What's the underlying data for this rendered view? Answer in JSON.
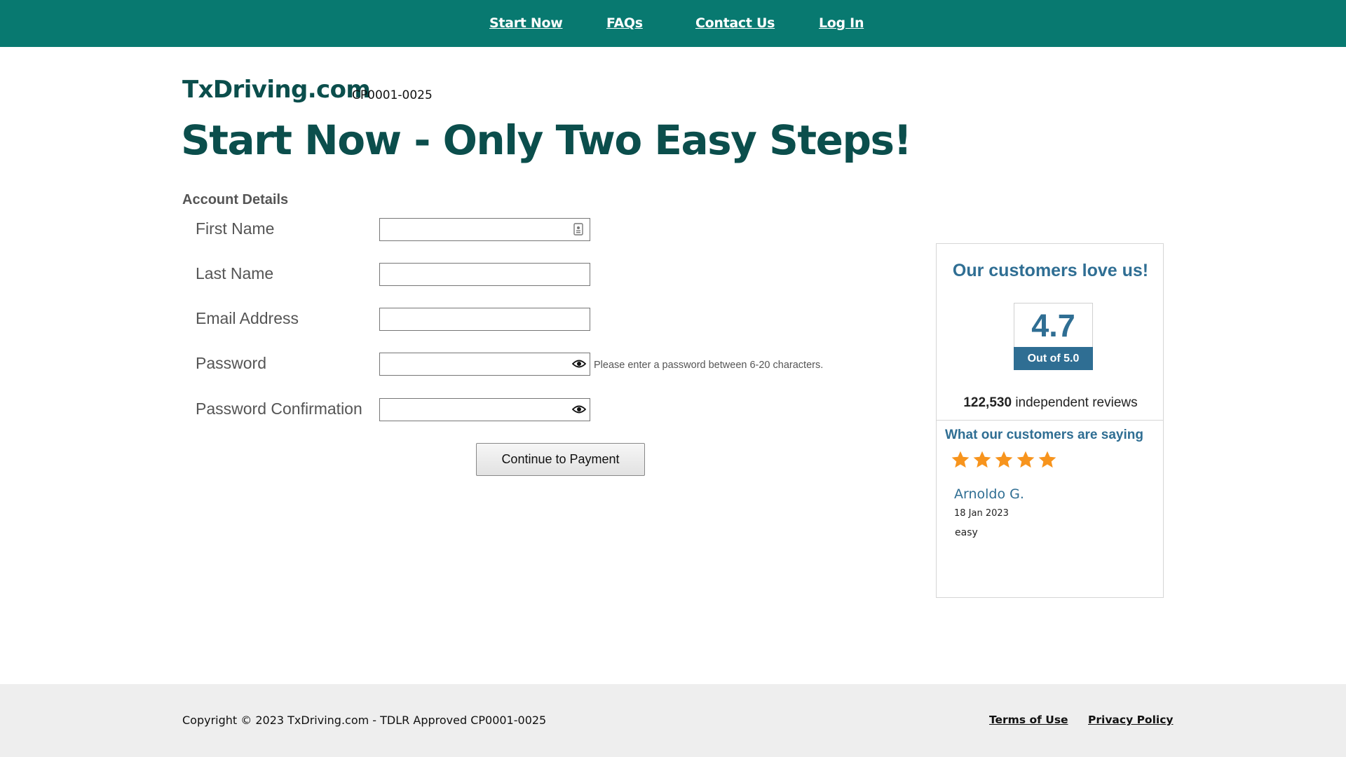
{
  "nav": {
    "items": [
      {
        "label": "Start Now"
      },
      {
        "label": "FAQs"
      },
      {
        "label": "Contact Us"
      },
      {
        "label": "Log In"
      }
    ]
  },
  "brand": {
    "name": "TxDriving.com",
    "code": "CP0001-0025"
  },
  "headline": "Start Now - Only Two Easy Steps!",
  "form": {
    "section_title": "Account Details",
    "fields": [
      {
        "label": "First Name",
        "value": "",
        "icon": "contact-card-icon"
      },
      {
        "label": "Last Name",
        "value": ""
      },
      {
        "label": "Email Address",
        "value": ""
      },
      {
        "label": "Password",
        "value": "",
        "icon": "eye-icon"
      },
      {
        "label": "Password Confirmation",
        "value": "",
        "icon": "eye-icon"
      }
    ],
    "password_hint": "Please enter a password between 6-20 characters.",
    "submit_label": "Continue to Payment"
  },
  "reviews": {
    "title": "Our customers love us!",
    "score": "4.7",
    "score_caption": "Out of 5.0",
    "count": "122,530",
    "count_suffix": " independent reviews",
    "saying_title": "What our customers are saying",
    "rating_stars": 5,
    "reviewer": "Arnoldo G.",
    "date": "18 Jan 2023",
    "text": "easy",
    "colors": {
      "accent": "#2f6e93",
      "star": "#f7941d"
    }
  },
  "footer": {
    "copyright": "Copyright © 2023 TxDriving.com - TDLR Approved CP0001-0025",
    "links": [
      {
        "label": "Terms of Use"
      },
      {
        "label": "Privacy Policy"
      }
    ]
  },
  "colors": {
    "nav_bg": "#087970",
    "brand": "#0b4e4c",
    "footer_bg": "#eeeeee"
  }
}
